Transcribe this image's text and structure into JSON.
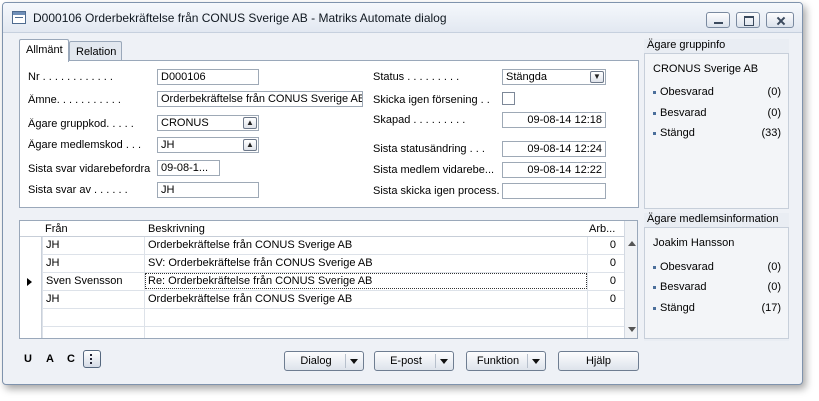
{
  "window": {
    "title": "D000106 Orderbekräftelse från CONUS Sverige AB - Matriks Automate dialog"
  },
  "tabs": [
    {
      "label": "Allmänt",
      "active": true
    },
    {
      "label": "Relation",
      "active": false
    }
  ],
  "general": {
    "nr_label": "Nr . . . . . . . . . . . .",
    "nr_value": "D000106",
    "amne_label": "Ämne. . . . . . . . . . .",
    "amne_value": "Orderbekräftelse från CONUS Sverige AB",
    "agare_grupp_label": "Ägare gruppkod. . . . .",
    "agare_grupp_value": "CRONUS",
    "agare_medlem_label": "Ägare medlemskod . . .",
    "agare_medlem_value": "JH",
    "sista_svar_vid_label": "Sista svar vidarebefordra",
    "sista_svar_vid_value": "09-08-1...",
    "sista_svar_av_label": "Sista svar av . . . . . .",
    "sista_svar_av_value": "JH",
    "status_label": "Status . . . . . . . . .",
    "status_value": "Stängda",
    "skicka_label": "Skicka igen försening . .",
    "skapad_label": "Skapad . . . . . . . . .",
    "skapad_value": "09-08-14 12:18",
    "sista_status_label": "Sista statusändring . . .",
    "sista_status_value": "09-08-14 12:24",
    "sista_medlem_label": "Sista medlem vidarebe...",
    "sista_medlem_value": "09-08-14 12:22",
    "sista_skicka_label": "Sista skicka igen process.",
    "sista_skicka_value": ""
  },
  "group_panel": {
    "title": "Ägare gruppinfo",
    "name": "CRONUS Sverige AB",
    "items": [
      {
        "label": "Obesvarad",
        "count": "(0)"
      },
      {
        "label": "Besvarad",
        "count": "(0)"
      },
      {
        "label": "Stängd",
        "count": "(33)"
      }
    ]
  },
  "member_panel": {
    "title": "Ägare medlemsinformation",
    "name": "Joakim Hansson",
    "items": [
      {
        "label": "Obesvarad",
        "count": "(0)"
      },
      {
        "label": "Besvarad",
        "count": "(0)"
      },
      {
        "label": "Stängd",
        "count": "(17)"
      }
    ]
  },
  "table": {
    "headers": [
      "Från",
      "Beskrivning",
      "Arb..."
    ],
    "rows": [
      {
        "from": "JH",
        "desc": "Orderbekräftelse från CONUS Sverige AB",
        "arb": "0"
      },
      {
        "from": "JH",
        "desc": "SV: Orderbekräftelse från CONUS Sverige AB",
        "arb": "0"
      },
      {
        "from": "Sven Svensson",
        "desc": "Re: Orderbekräftelse från CONUS Sverige AB",
        "arb": "0"
      },
      {
        "from": "JH",
        "desc": "Orderbekräftelse från CONUS Sverige AB",
        "arb": "0"
      }
    ]
  },
  "footer": {
    "u": "U",
    "a": "A",
    "c": "C",
    "buttons": {
      "dialog": "Dialog",
      "epost": "E-post",
      "funktion": "Funktion",
      "hjalp": "Hjälp"
    }
  }
}
